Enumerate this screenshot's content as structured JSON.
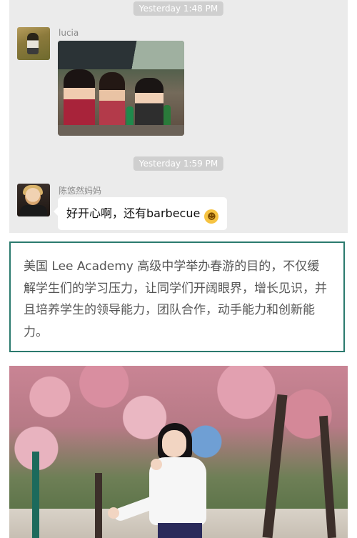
{
  "chat": {
    "messages": [
      {
        "timestamp": "Yesterday 1:48 PM",
        "sender": "lucia",
        "content_type": "image"
      },
      {
        "timestamp": "Yesterday 1:59 PM",
        "sender": "陈悠然妈妈",
        "text": "好开心啊，还有barbecue",
        "emoji": "grinning-face-emoji"
      }
    ]
  },
  "article": {
    "paragraph": "美国 Lee Academy 高级中学举办春游的目的，不仅缓解学生们的学习压力，让同学们开阔眼界，增长见识，并且培养学生的领导能力，团队合作，动手能力和创新能力。"
  },
  "colors": {
    "chat_background": "#ebebeb",
    "timestamp_pill": "#cfcfcf",
    "quote_border": "#2b7a6e",
    "body_text": "#555555"
  }
}
